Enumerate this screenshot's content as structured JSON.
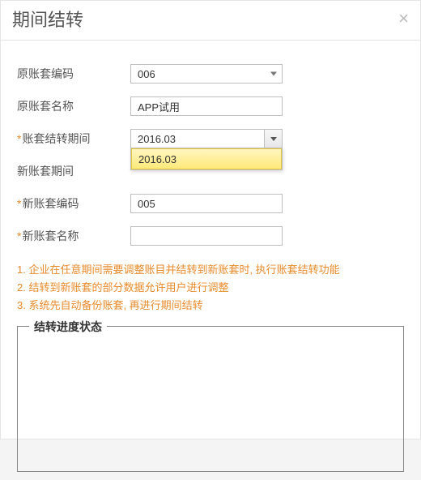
{
  "dialog": {
    "title": "期间结转",
    "close_glyph": "×"
  },
  "form": {
    "orig_code": {
      "label": "原账套编码",
      "value": "006"
    },
    "orig_name": {
      "label": "原账套名称",
      "value": "APP试用"
    },
    "carry_period": {
      "label": "账套结转期间",
      "required": true,
      "value": "2016.03"
    },
    "new_period": {
      "label": "新账套期间",
      "value": ""
    },
    "new_code": {
      "label": "新账套编码",
      "required": true,
      "value": "005"
    },
    "new_name": {
      "label": "新账套名称",
      "required": true,
      "value": ""
    }
  },
  "dropdown": {
    "options": [
      "2016.03"
    ]
  },
  "notes": {
    "l1": "1. 企业在任意期间需要调整账目并结转到新账套时, 执行账套结转功能",
    "l2": "2. 结转到新账套的部分数据允许用户进行调整",
    "l3": "3. 系统先自动备份账套, 再进行期间结转"
  },
  "progress": {
    "legend": "结转进度状态"
  }
}
